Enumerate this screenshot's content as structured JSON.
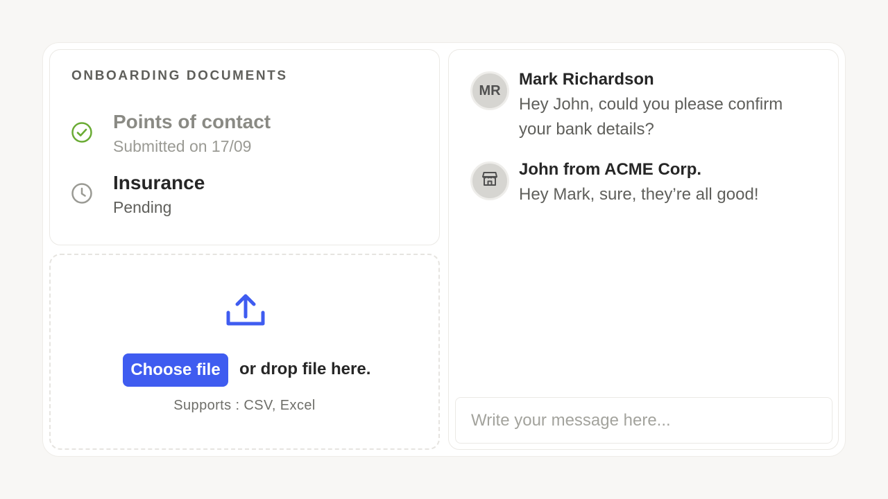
{
  "documents": {
    "title": "ONBOARDING DOCUMENTS",
    "items": [
      {
        "name": "Points of contact",
        "status": "Submitted on 17/09",
        "icon": "check-circle-icon"
      },
      {
        "name": "Insurance",
        "status": "Pending",
        "icon": "clock-icon"
      }
    ]
  },
  "upload": {
    "icon": "upload-icon",
    "button_label": "Choose file",
    "drop_text": "or drop file here.",
    "supports": "Supports : CSV, Excel"
  },
  "chat": {
    "messages": [
      {
        "initials": "MR",
        "sender": "Mark Richardson",
        "text": "Hey John, could you please confirm your bank details?"
      },
      {
        "avatar_icon": "storefront-icon",
        "sender": "John from ACME Corp.",
        "text": "Hey Mark, sure, they’re all good!"
      }
    ],
    "input_placeholder": "Write your message here..."
  },
  "colors": {
    "accent": "#3f5cf0",
    "success": "#6aab34",
    "muted_icon": "#9a9a94"
  }
}
